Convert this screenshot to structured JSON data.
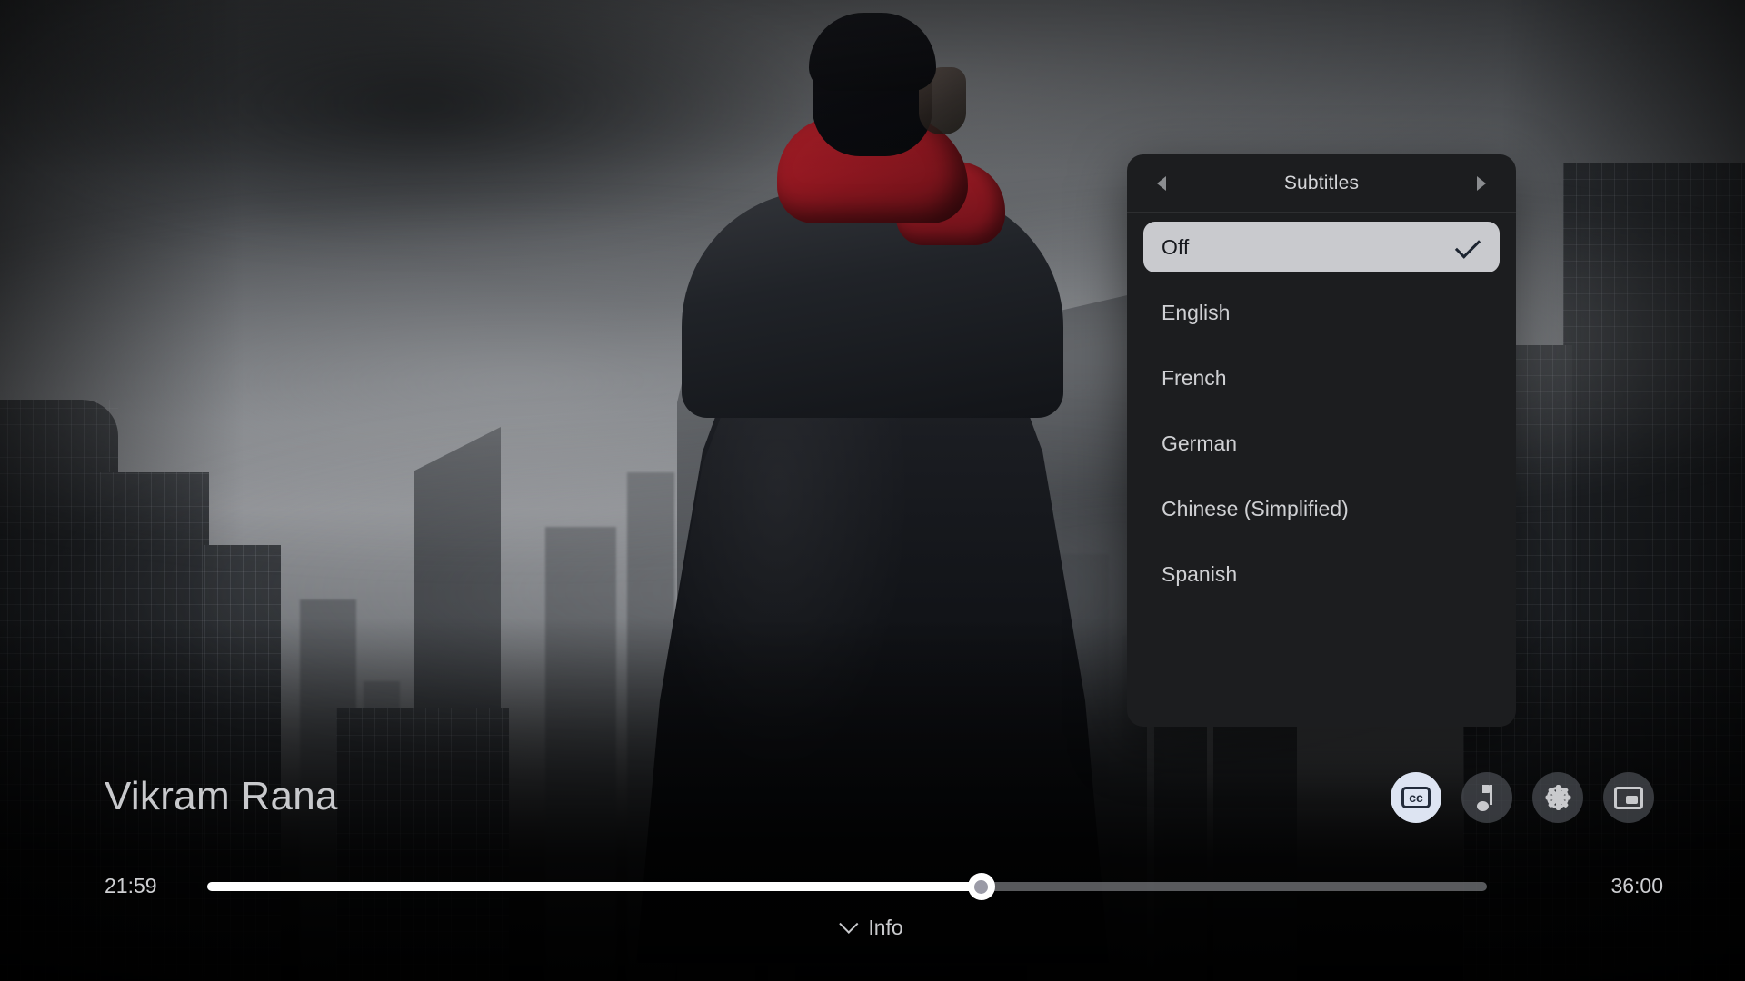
{
  "player": {
    "title": "Vikram Rana",
    "time_current": "21:59",
    "time_duration": "36:00",
    "progress_percent": 60.5,
    "info_label": "Info"
  },
  "subtitles_panel": {
    "title": "Subtitles",
    "prev_icon": "caret-left-icon",
    "next_icon": "caret-right-icon",
    "selected_option": "Off",
    "check_icon": "check-icon",
    "options": [
      {
        "label": "Off",
        "selected": true
      },
      {
        "label": "English",
        "selected": false
      },
      {
        "label": "French",
        "selected": false
      },
      {
        "label": "German",
        "selected": false
      },
      {
        "label": "Chinese (Simplified)",
        "selected": false
      },
      {
        "label": "Spanish",
        "selected": false
      }
    ]
  },
  "controls": [
    {
      "name": "subtitles-button",
      "icon": "cc-icon",
      "label": "cc",
      "active": true
    },
    {
      "name": "audio-track-button",
      "icon": "music-note-icon",
      "label": "",
      "active": false
    },
    {
      "name": "settings-button",
      "icon": "gear-icon",
      "label": "",
      "active": false
    },
    {
      "name": "picture-in-picture-button",
      "icon": "picture-in-picture-icon",
      "label": "",
      "active": false
    }
  ],
  "colors": {
    "panel_background": "#1c1d1f",
    "selected_row": "#c9cace",
    "accent_active_button": "#dde4f2",
    "progress_fill": "#ffffff",
    "text_primary": "#cfd0d3",
    "scarf_red": "#9d1b24"
  }
}
